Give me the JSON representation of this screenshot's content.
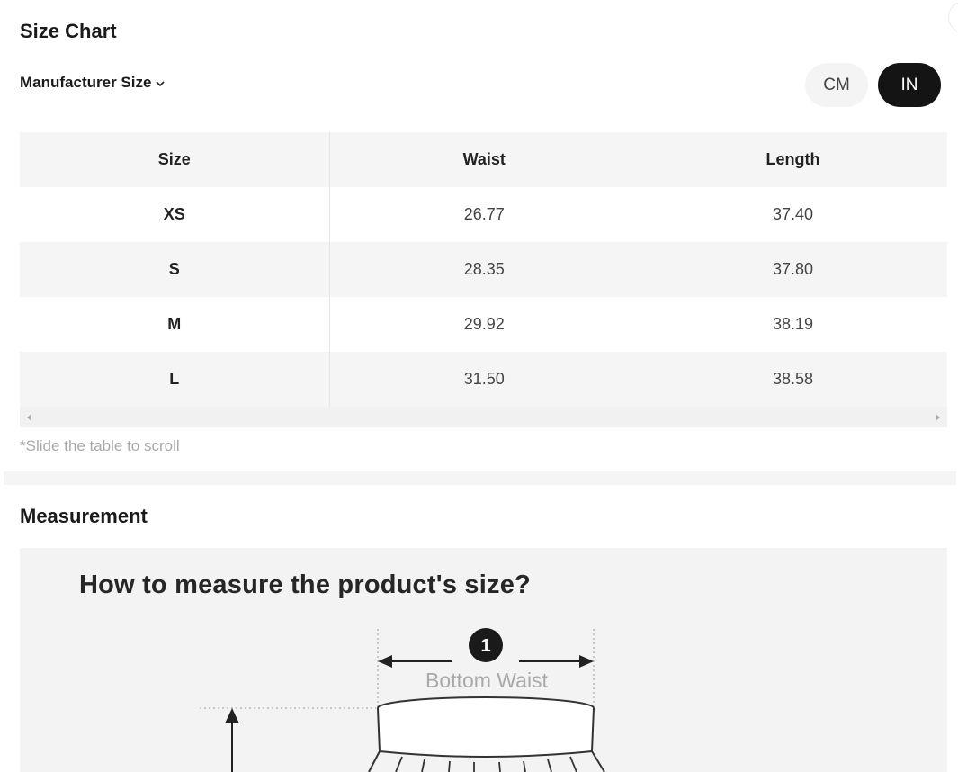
{
  "size_chart": {
    "title": "Size Chart",
    "manufacturer_label": "Manufacturer Size",
    "units": {
      "cm": "CM",
      "in": "IN",
      "selected": "IN"
    },
    "table": {
      "headers": [
        "Size",
        "Waist",
        "Length"
      ],
      "rows": [
        [
          "XS",
          "26.77",
          "37.40"
        ],
        [
          "S",
          "28.35",
          "37.80"
        ],
        [
          "M",
          "29.92",
          "38.19"
        ],
        [
          "L",
          "31.50",
          "38.58"
        ]
      ]
    },
    "scroll_hint": "*Slide the table to scroll"
  },
  "measurement": {
    "title": "Measurement",
    "heading": "How to measure the product's size?",
    "marker_number": "1",
    "marker_label": "Bottom Waist"
  },
  "colors": {
    "selected_unit_bg": "#141414",
    "table_stripe": "#f5f5f5",
    "hint_text": "#aaaaaa"
  }
}
